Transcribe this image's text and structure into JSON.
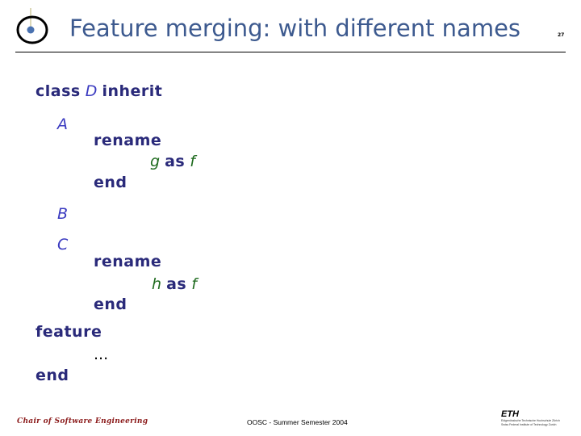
{
  "slide": {
    "title": "Feature merging: with different names",
    "page_number": "27"
  },
  "code": {
    "line1": {
      "kw1": "class",
      "cls": "D",
      "kw2": "inherit"
    },
    "parent_a": "A",
    "rename_a": "rename",
    "rename_a_item": {
      "old": "g",
      "kw": "as",
      "new": "f"
    },
    "end_a": "end",
    "parent_b": "B",
    "parent_c": "C",
    "rename_c": "rename",
    "rename_c_item": {
      "old": "h",
      "kw": "as",
      "new": "f"
    },
    "end_c": "end",
    "feature_kw": "feature",
    "ellipsis": "...",
    "end_class": "end"
  },
  "footer": {
    "left": "Chair of Software Engineering",
    "center": "OOSC - Summer Semester 2004",
    "eth_mark": "ETH",
    "eth_line1": "Eidgenössische Technische Hochschule Zürich",
    "eth_line2": "Swiss Federal Institute of Technology Zurich"
  },
  "colors": {
    "title": "#3d5a8f",
    "keyword": "#2a2a7a",
    "class_name": "#3a3ac0",
    "feature_name": "#1f6b1f",
    "footer_left": "#8b1a1a"
  }
}
